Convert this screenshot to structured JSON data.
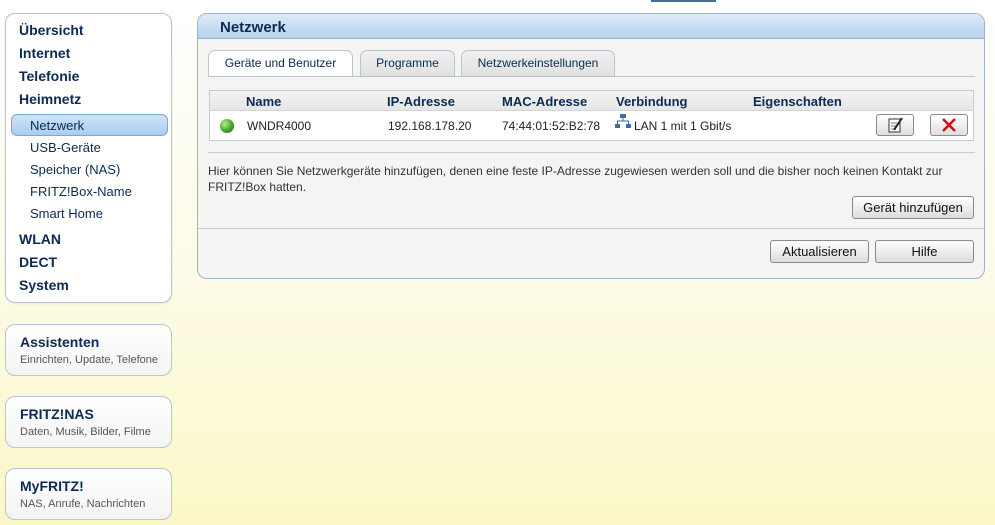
{
  "sidebar": {
    "main": {
      "uebersicht": "Übersicht",
      "internet": "Internet",
      "telefonie": "Telefonie",
      "heimnetz": "Heimnetz",
      "wlan": "WLAN",
      "dect": "DECT",
      "system": "System"
    },
    "sub": {
      "netzwerk": "Netzwerk",
      "usb": "USB-Geräte",
      "nas": "Speicher (NAS)",
      "boxname": "FRITZ!Box-Name",
      "smarthome": "Smart Home"
    },
    "active_item": "Netzwerk"
  },
  "boxes": {
    "assistenten": {
      "title": "Assistenten",
      "subtitle": "Einrichten, Update, Telefone"
    },
    "fritznas": {
      "title": "FRITZ!NAS",
      "subtitle": "Daten, Musik, Bilder, Filme"
    },
    "myfritz": {
      "title": "MyFRITZ!",
      "subtitle": "NAS, Anrufe, Nachrichten"
    }
  },
  "panel": {
    "title": "Netzwerk",
    "tabs": [
      "Geräte und Benutzer",
      "Programme",
      "Netzwerkeinstellungen"
    ],
    "active_tab": "Geräte und Benutzer"
  },
  "table": {
    "headers": [
      "Name",
      "IP-Adresse",
      "MAC-Adresse",
      "Verbindung",
      "Eigenschaften"
    ],
    "rows": [
      {
        "name": "WNDR4000",
        "ip": "192.168.178.20",
        "mac": "74:44:01:52:B2:78",
        "connection": "LAN 1 mit 1 Gbit/s",
        "status_icon": "globe-icon"
      }
    ]
  },
  "info_text": "Hier können Sie Netzwerkgeräte hinzufügen, denen eine feste IP-Adresse zugewiesen werden soll und die bisher noch keinen Kontakt zur FRITZ!Box hatten.",
  "buttons": {
    "add_device": "Gerät hinzufügen",
    "refresh": "Aktualisieren",
    "help": "Hilfe"
  },
  "colors": {
    "accent": "#0c2a52",
    "header_blue": "#b6d3ef",
    "delete_red": "#d01010"
  }
}
